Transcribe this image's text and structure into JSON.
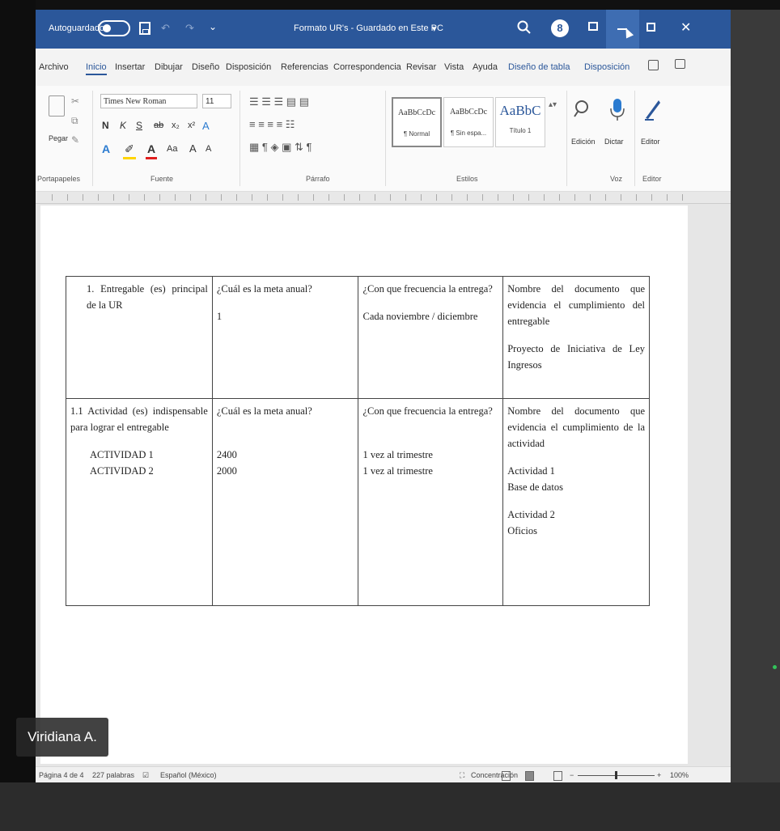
{
  "window": {
    "autosave_label": "Autoguardado",
    "doc_title": "Formato UR's - Guardado en Este PC",
    "title_caret": "▾",
    "avatar_initial": "8",
    "brand_color": "#2b579a"
  },
  "tabs": [
    {
      "label": "Archivo",
      "state": "normal"
    },
    {
      "label": "Inicio",
      "state": "active"
    },
    {
      "label": "Insertar",
      "state": "normal"
    },
    {
      "label": "Dibujar",
      "state": "normal"
    },
    {
      "label": "Diseño",
      "state": "normal"
    },
    {
      "label": "Disposición",
      "state": "normal"
    },
    {
      "label": "Referencias",
      "state": "normal"
    },
    {
      "label": "Correspondencia",
      "state": "normal"
    },
    {
      "label": "Revisar",
      "state": "normal"
    },
    {
      "label": "Vista",
      "state": "normal"
    },
    {
      "label": "Ayuda",
      "state": "normal"
    },
    {
      "label": "Diseño de tabla",
      "state": "contextual"
    },
    {
      "label": "Disposición",
      "state": "contextual"
    }
  ],
  "ribbon": {
    "clipboard": {
      "paste": "Pegar",
      "group": "Portapapeles"
    },
    "font": {
      "name": "Times New Roman",
      "size": "11",
      "group": "Fuente",
      "buttons": [
        "N",
        "K",
        "S",
        "ab",
        "x₂",
        "x²",
        "Aa",
        "A",
        "A"
      ]
    },
    "paragraph": {
      "group": "Párrafo"
    },
    "styles": {
      "group": "Estilos",
      "items": [
        {
          "sample": "AaBbCcDc",
          "name": "¶ Normal"
        },
        {
          "sample": "AaBbCcDc",
          "name": "¶ Sin espa..."
        },
        {
          "sample": "AaBbC",
          "name": "Título 1"
        }
      ]
    },
    "editing": {
      "label": "Edición"
    },
    "voice": {
      "label": "Dictar",
      "group": "Voz"
    },
    "editor": {
      "label": "Editor",
      "group": "Editor"
    }
  },
  "document": {
    "row1": {
      "col1": "1.  Entregable (es) principal de la UR",
      "col2_q": "¿Cuál es la meta anual?",
      "col2_a": "1",
      "col3_q": "¿Con que frecuencia la entrega?",
      "col3_a": "Cada noviembre / diciembre",
      "col4_q": "Nombre del documento que evidencia el cumplimiento del entregable",
      "col4_a": "Proyecto de Iniciativa de Ley Ingresos"
    },
    "row2": {
      "col1": "1.1 Actividad (es) indispensable para lograr el entregable",
      "act1": "ACTIVIDAD 1",
      "act2": "ACTIVIDAD 2",
      "col2_q": "¿Cuál es la meta anual?",
      "val1": "2400",
      "val2": "2000",
      "col3_q": "¿Con que frecuencia la entrega?",
      "freq1": "1 vez al trimestre",
      "freq2": "1 vez al trimestre",
      "col4_q": "Nombre del documento que evidencia el cumplimiento de la actividad",
      "ev1_title": "Actividad 1",
      "ev1_val": "Base de datos",
      "ev2_title": "Actividad 2",
      "ev2_val": "Oficios"
    }
  },
  "participant": {
    "name": "Viridiana A."
  },
  "status": {
    "page": "Página 4 de 4",
    "words": "227 palabras",
    "language": "Español (México)",
    "focus": "Concentración",
    "zoom": "100%"
  }
}
